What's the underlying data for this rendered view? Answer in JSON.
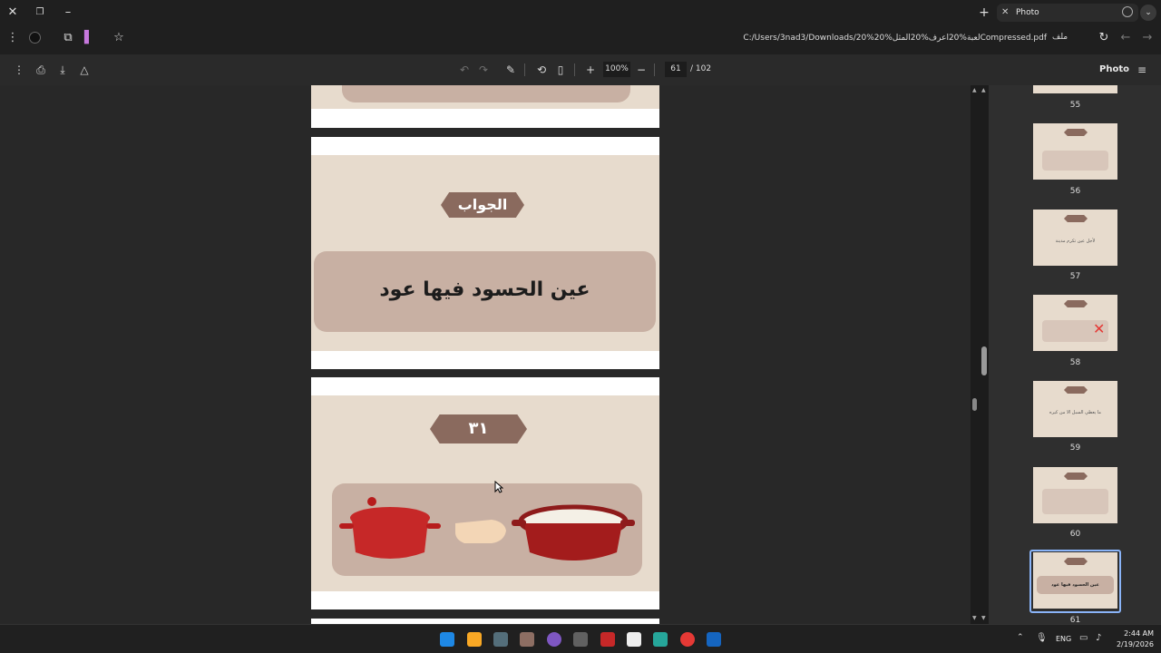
{
  "tab": {
    "title": "Photo"
  },
  "address": {
    "file_label": "ملف",
    "url": "C:/Users/3nad3/Downloads/لعبة%20اعرف%20المثل%20%20Compressed.pdf"
  },
  "toolbar": {
    "zoom": "100%",
    "page_current": "61",
    "page_total": "/ 102",
    "doc_title": "Photo"
  },
  "pages": [
    {
      "banner": "الجواب",
      "answer": "عين الحسود فيها عود"
    },
    {
      "banner": "٣١"
    }
  ],
  "thumbnails": [
    {
      "number": "55"
    },
    {
      "number": "56",
      "banner": "٢٨"
    },
    {
      "number": "57",
      "banner": "الجواب",
      "text": "لأجل عين تكرم مدينة"
    },
    {
      "number": "58",
      "banner": "٢٩"
    },
    {
      "number": "59",
      "banner": "الجواب",
      "text": "ما يعطي السبل الا من كيره"
    },
    {
      "number": "60",
      "banner": "٣٠"
    },
    {
      "number": "61",
      "banner": "الجواب",
      "text": "عين الحسود فيها عود"
    }
  ],
  "taskbar": {
    "lang": "ENG",
    "time": "2:44 AM",
    "date": "2/19/2026"
  },
  "colors": {
    "accent": "#8ab4f8",
    "slide_bg": "#e7dbcd",
    "banner": "#8a6a5e",
    "answer_box": "#c8b0a3"
  }
}
